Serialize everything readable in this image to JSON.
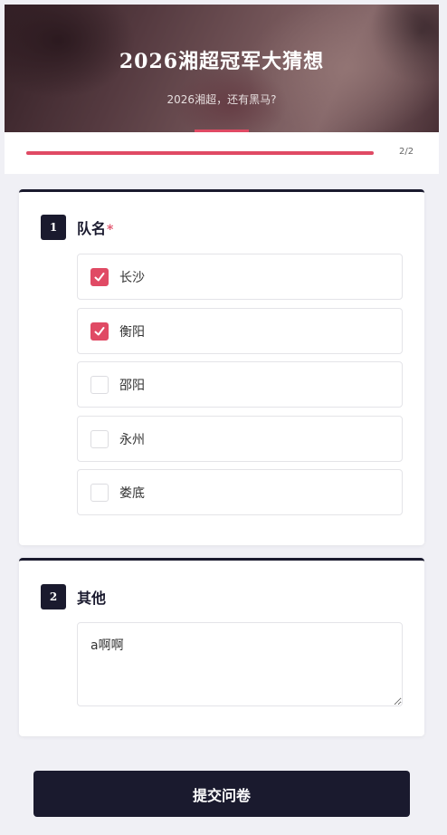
{
  "header": {
    "title": "2026湘超冠军大猜想",
    "subtitle": "2026湘超，还有黑马?"
  },
  "progress": {
    "text": "2/2",
    "fraction": 1.0
  },
  "question1": {
    "number": "1",
    "title": "队名",
    "required_mark": "*",
    "options": [
      {
        "label": "长沙",
        "checked": true
      },
      {
        "label": "衡阳",
        "checked": true
      },
      {
        "label": "邵阳",
        "checked": false
      },
      {
        "label": "永州",
        "checked": false
      },
      {
        "label": "娄底",
        "checked": false
      }
    ]
  },
  "question2": {
    "number": "2",
    "title": "其他",
    "value": "a啊啊"
  },
  "submit": {
    "label": "提交问卷"
  },
  "colors": {
    "accent": "#e04a64",
    "dark": "#1a1a2e"
  }
}
